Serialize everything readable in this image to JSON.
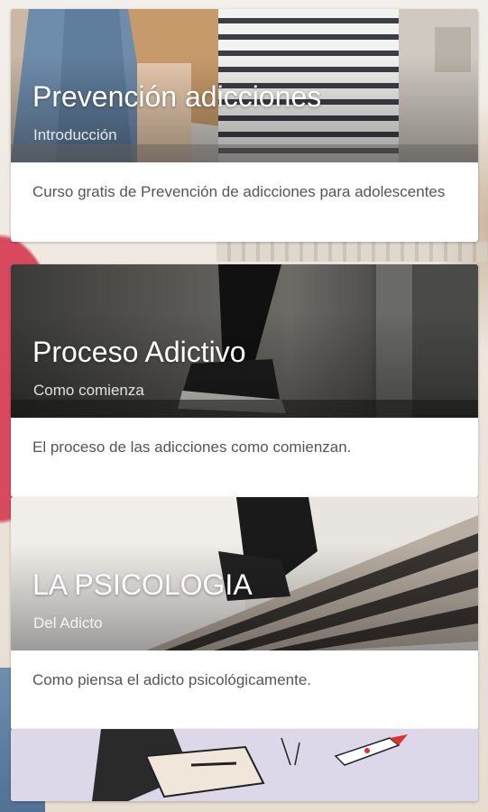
{
  "cards": [
    {
      "title": "Prevención adicciones",
      "subtitle": "Introducción",
      "description": "Curso gratis de Prevención de adicciones para adolescentes"
    },
    {
      "title": "Proceso Adictivo",
      "subtitle": "Como comienza",
      "description": "El proceso de las adicciones como comienzan."
    },
    {
      "title": "LA PSICOLOGIA",
      "subtitle": "Del Adicto",
      "description": "Como piensa el adicto psicológicamente."
    },
    {
      "title": "",
      "subtitle": "",
      "description": ""
    }
  ]
}
